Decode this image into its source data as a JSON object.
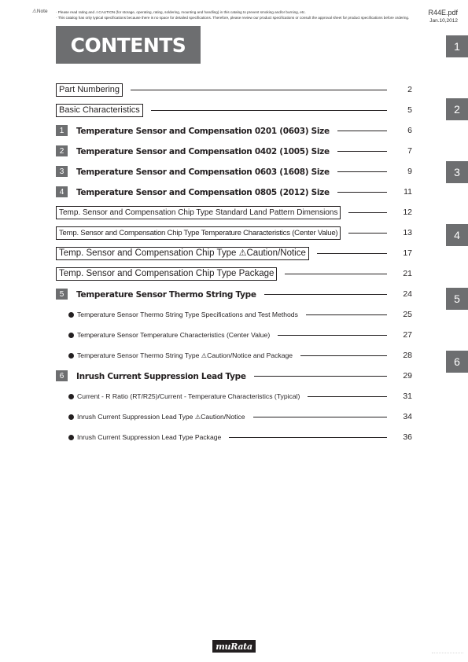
{
  "header": {
    "note_label": "⚠Note",
    "note_lines": [
      "· Please read rating and ⚠CAUTION (for storage, operating, rating, soldering, mounting and handling) in this catalog to prevent smoking and/or burning, etc.",
      "· This catalog has only typical specifications because there is no space for detailed specifications. Therefore, please review our product specifications or consult the approval sheet for product specifications before ordering."
    ],
    "doc_id": "R44E.pdf",
    "doc_date": "Jan.10,2012"
  },
  "title": "CONTENTS",
  "side_tabs": [
    "1",
    "2",
    "3",
    "4",
    "5",
    "6"
  ],
  "toc": {
    "boxed_top": [
      {
        "label": "Part Numbering",
        "page": "2"
      },
      {
        "label": "Basic Characteristics",
        "page": "5"
      }
    ],
    "sections_a": [
      {
        "num": "1",
        "label": "Temperature Sensor and Compensation 0201 (0603) Size",
        "page": "6"
      },
      {
        "num": "2",
        "label": "Temperature Sensor and Compensation 0402 (1005) Size",
        "page": "7"
      },
      {
        "num": "3",
        "label": "Temperature Sensor and Compensation 0603 (1608) Size",
        "page": "9"
      },
      {
        "num": "4",
        "label": "Temperature Sensor and Compensation 0805 (2012) Size",
        "page": "11"
      }
    ],
    "boxed_mid": [
      {
        "label": "Temp. Sensor and Compensation Chip Type Standard Land Pattern Dimensions",
        "page": "12"
      },
      {
        "label": "Temp. Sensor and Compensation Chip Type Temperature Characteristics (Center Value)",
        "page": "13"
      },
      {
        "label_pre": "Temp. Sensor and Compensation Chip Type ",
        "icon": "⚠",
        "label_post": "Caution/Notice",
        "page": "17"
      },
      {
        "label": "Temp. Sensor and Compensation Chip Type Package",
        "page": "21"
      }
    ],
    "section5": {
      "num": "5",
      "label": "Temperature Sensor Thermo String Type",
      "page": "24",
      "subs": [
        {
          "label": "Temperature Sensor Thermo String Type Specifications and Test Methods",
          "page": "25"
        },
        {
          "label": "Temperature Sensor Temperature Characteristics (Center Value)",
          "page": "27"
        },
        {
          "label_pre": "Temperature Sensor Thermo String Type ",
          "icon": "⚠",
          "label_post": "Caution/Notice and Package",
          "page": "28"
        }
      ]
    },
    "section6": {
      "num": "6",
      "label": "Inrush Current Suppression Lead Type",
      "page": "29",
      "subs": [
        {
          "label": "Current - R Ratio (RT/R25)/Current - Temperature Characteristics (Typical)",
          "page": "31"
        },
        {
          "label_pre": "Inrush Current Suppression Lead Type ",
          "icon": "⚠",
          "label_post": "Caution/Notice",
          "page": "34"
        },
        {
          "label": "Inrush Current Suppression Lead Type Package",
          "page": "36"
        }
      ]
    }
  },
  "footer": {
    "logo_text": "muRata"
  }
}
